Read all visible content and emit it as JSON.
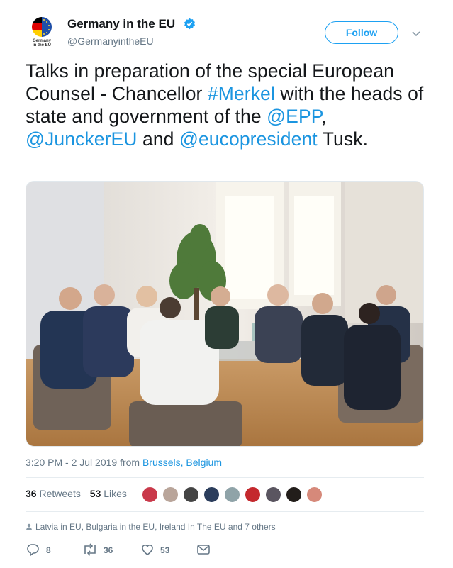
{
  "account": {
    "name": "Germany in the EU",
    "handle": "@GermanyintheEU",
    "avatar_caption_line1": "Germany",
    "avatar_caption_line2": "in the EU",
    "verified_icon": "verified-badge-icon"
  },
  "follow_label": "Follow",
  "tweet": {
    "part1": "Talks in preparation of the special European Counsel  - Chancellor ",
    "hashtag_merkel": "#Merkel",
    "part2": " with the heads of state and government of the ",
    "mention_epp": "@EPP",
    "sep1": ", ",
    "mention_juncker": "@JunckerEU",
    "sep2": " and ",
    "mention_eucopresident": "@eucopresident",
    "part3": " Tusk."
  },
  "timestamp": {
    "time": "3:20 PM - 2 Jul 2019",
    "from_label": " from ",
    "location": "Brussels, Belgium"
  },
  "stats": {
    "retweets_count": "36",
    "retweets_label": "Retweets",
    "likes_count": "53",
    "likes_label": "Likes"
  },
  "liked_by": "Latvia in EU, Bulgaria in the EU, Ireland In The EU and 7 others",
  "actions": {
    "reply_count": "8",
    "retweet_count": "36",
    "like_count": "53"
  },
  "colors": {
    "link": "#1b95e0",
    "follow": "#1da1f2",
    "muted": "#657786",
    "text": "#14171a"
  }
}
